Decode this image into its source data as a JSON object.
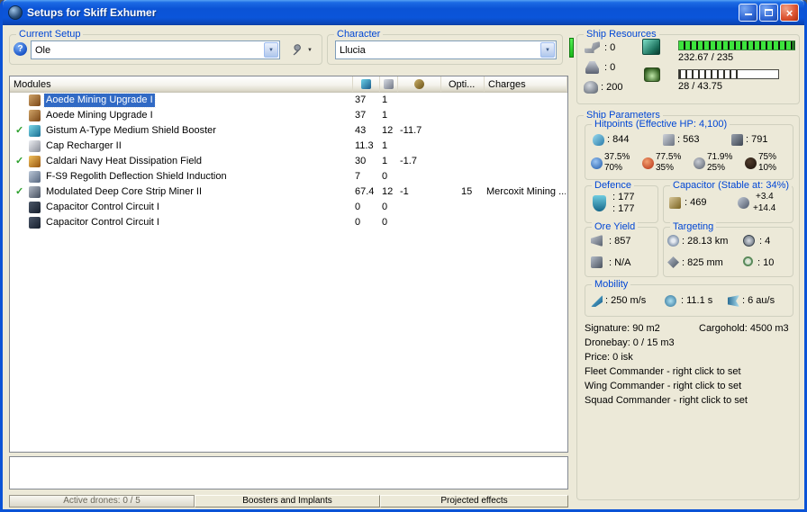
{
  "window": {
    "title": "Setups for Skiff Exhumer"
  },
  "colors": {
    "selection": "#316ac5",
    "group_label": "#0046d5",
    "cpu_bar_green": "#3ce43c",
    "character_status_green": "#2ee52e",
    "titlebar_blue": "#0b53d6"
  },
  "icons": {
    "help": "?",
    "check": "✓",
    "dropdown_arrow": "▼",
    "close": "×"
  },
  "current_setup": {
    "label": "Current Setup",
    "value": "Ole"
  },
  "character": {
    "label": "Character",
    "value": "Llucia"
  },
  "ship_resources": {
    "label": "Ship Resources",
    "turrets": ": 0",
    "launchers": ": 0",
    "drones": ": 200",
    "cpu_text": "232.67 / 235",
    "cpu_pct": 99,
    "powergrid_text": "28 / 43.75",
    "powergrid_pct": 64
  },
  "modules": {
    "header": "Modules",
    "opti_header": "Opti...",
    "charges_header": "Charges",
    "rows": [
      {
        "name": "Aoede Mining Upgrade I",
        "cpu": "37",
        "pg": "1",
        "cap": "",
        "opti": "",
        "charge": ""
      },
      {
        "name": "Aoede Mining Upgrade I",
        "cpu": "37",
        "pg": "1",
        "cap": "",
        "opti": "",
        "charge": ""
      },
      {
        "name": "Gistum A-Type Medium Shield Booster",
        "cpu": "43",
        "pg": "12",
        "cap": "-11.7",
        "opti": "",
        "charge": ""
      },
      {
        "name": "Cap Recharger II",
        "cpu": "11.3",
        "pg": "1",
        "cap": "",
        "opti": "",
        "charge": ""
      },
      {
        "name": "Caldari Navy Heat Dissipation Field",
        "cpu": "30",
        "pg": "1",
        "cap": "-1.7",
        "opti": "",
        "charge": ""
      },
      {
        "name": "F-S9 Regolith Deflection Shield Induction",
        "cpu": "7",
        "pg": "0",
        "cap": "",
        "opti": "",
        "charge": ""
      },
      {
        "name": "Modulated Deep Core Strip Miner II",
        "cpu": "67.4",
        "pg": "12",
        "cap": "-1",
        "opti": "15",
        "charge": "Mercoxit Mining ..."
      },
      {
        "name": "Capacitor Control Circuit I",
        "cpu": "0",
        "pg": "0",
        "cap": "",
        "opti": "",
        "charge": ""
      },
      {
        "name": "Capacitor Control Circuit I",
        "cpu": "0",
        "pg": "0",
        "cap": "",
        "opti": "",
        "charge": ""
      }
    ]
  },
  "ship_parameters": {
    "label": "Ship Parameters",
    "hitpoints": {
      "label": "Hitpoints (Effective HP: 4,100)",
      "shield": ": 844",
      "armor": ": 563",
      "structure": ": 791",
      "resists": [
        {
          "top": "37.5%",
          "bottom": "70%"
        },
        {
          "top": "77.5%",
          "bottom": "35%"
        },
        {
          "top": "71.9%",
          "bottom": "25%"
        },
        {
          "top": "75%",
          "bottom": "10%"
        }
      ]
    },
    "defence": {
      "label": "Defence",
      "value1": ": 177",
      "value2": ": 177"
    },
    "capacitor": {
      "label": "Capacitor (Stable at: 34%)",
      "amount": ": 469",
      "delta": "+3.4",
      "recharge": "+14.4"
    },
    "ore_yield": {
      "label": "Ore Yield",
      "miner": ": 857",
      "ice": ": N/A"
    },
    "targeting": {
      "label": "Targeting",
      "range": ": 28.13 km",
      "max_targets": ": 4",
      "scan_res": ": 825 mm",
      "sensor_strength": ": 10"
    },
    "mobility": {
      "label": "Mobility",
      "speed": ": 250 m/s",
      "align": ": 11.1 s",
      "warp": ": 6 au/s"
    },
    "stats": {
      "signature": "Signature: 90 m2",
      "cargohold": "Cargohold: 4500 m3",
      "dronebay": "Dronebay: 0 / 15 m3",
      "price": "Price: 0 isk",
      "fleet": "Fleet Commander - right click to set",
      "wing": "Wing Commander - right click to set",
      "squad": "Squad Commander - right click to set"
    }
  },
  "bottom": {
    "active_drones": "Active drones: 0 / 5",
    "boosters": "Boosters and Implants",
    "projected": "Projected effects"
  }
}
